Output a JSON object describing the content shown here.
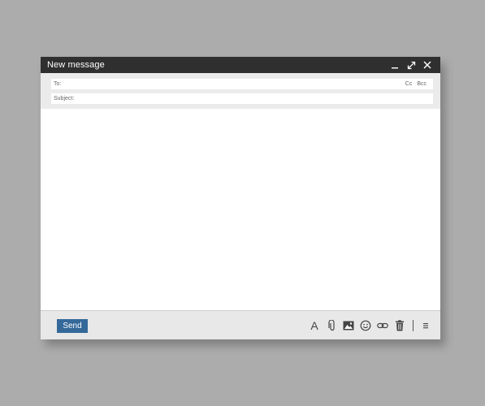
{
  "window": {
    "title": "New message",
    "controls": [
      "minimize-icon",
      "expand-icon",
      "close-icon"
    ]
  },
  "headers": {
    "to_label": "To:",
    "to_value": "",
    "cc_label": "Cc",
    "bcc_label": "Bcc",
    "subject_label": "Subject:",
    "subject_value": ""
  },
  "body": {
    "text": ""
  },
  "footer": {
    "send_label": "Send",
    "format_label": "A",
    "tools": [
      "formatting-icon",
      "attachment-icon",
      "image-icon",
      "emoji-icon",
      "link-icon",
      "trash-icon",
      "more-options-icon"
    ]
  },
  "colors": {
    "background": "#acacac",
    "titlebar": "#2f2f2f",
    "send_button": "#35699a",
    "header_band": "#ebebeb",
    "footer": "#e8e8e8"
  }
}
